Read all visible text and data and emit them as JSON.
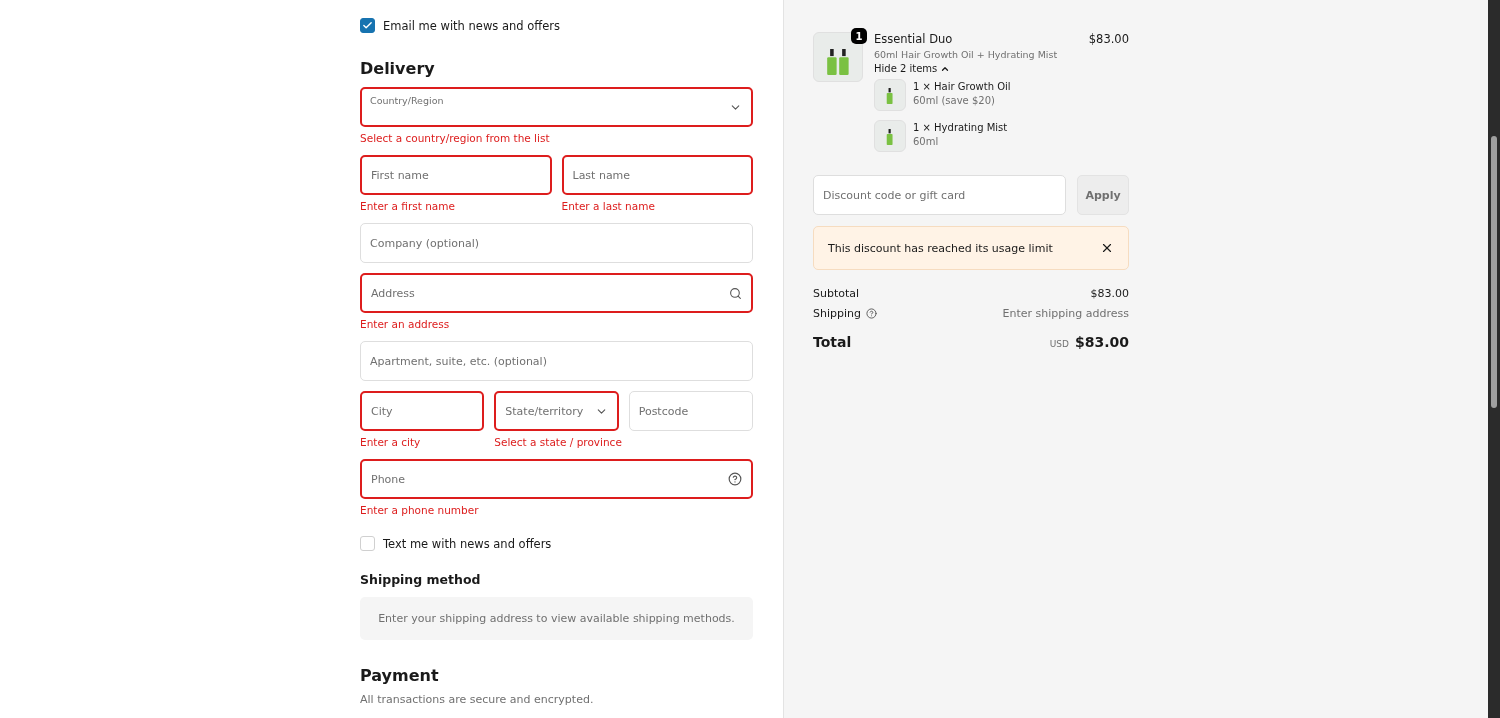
{
  "email_news": {
    "label": "Email me with news and offers",
    "checked": true
  },
  "delivery": {
    "heading": "Delivery",
    "rows": [
      [
        {
          "kind": "select",
          "label": "Country/Region",
          "invalid": true,
          "error": "Select a country/region from the list"
        }
      ],
      [
        {
          "kind": "text",
          "placeholder": "First name",
          "invalid": true,
          "error": "Enter a first name"
        },
        {
          "kind": "text",
          "placeholder": "Last name",
          "invalid": true,
          "error": "Enter a last name"
        }
      ],
      [
        {
          "kind": "text",
          "placeholder": "Company (optional)",
          "invalid": false
        }
      ],
      [
        {
          "kind": "search",
          "placeholder": "Address",
          "invalid": true,
          "error": "Enter an address"
        }
      ],
      [
        {
          "kind": "text",
          "placeholder": "Apartment, suite, etc. (optional)",
          "invalid": false
        }
      ],
      [
        {
          "kind": "text",
          "placeholder": "City",
          "invalid": true,
          "error": "Enter a city"
        },
        {
          "kind": "dropdown",
          "placeholder": "State/territory",
          "invalid": true,
          "error": "Select a state / province"
        },
        {
          "kind": "text",
          "placeholder": "Postcode",
          "invalid": false
        }
      ],
      [
        {
          "kind": "help",
          "placeholder": "Phone",
          "invalid": true,
          "error": "Enter a phone number"
        }
      ]
    ]
  },
  "text_news": {
    "label": "Text me with news and offers",
    "checked": false
  },
  "shipping_method": {
    "heading": "Shipping method",
    "message": "Enter your shipping address to view available shipping methods."
  },
  "payment": {
    "heading": "Payment",
    "subtitle": "All transactions are secure and encrypted."
  },
  "order": {
    "product": {
      "name": "Essential Duo",
      "variant": "60ml Hair Growth Oil + Hydrating Mist",
      "price": "$83.00",
      "quantity": "1",
      "toggle": "Hide 2 items",
      "expanded": true,
      "items": [
        {
          "name": "1 × Hair Growth Oil",
          "detail": "60ml (save $20)"
        },
        {
          "name": "1 × Hydrating Mist",
          "detail": "60ml"
        }
      ]
    },
    "discount": {
      "placeholder": "Discount code or gift card",
      "button": "Apply"
    },
    "alert": "This discount has reached its usage limit",
    "summary": [
      {
        "label": "Subtotal",
        "value": "$83.00",
        "help": false
      },
      {
        "label": "Shipping",
        "value": "Enter shipping address",
        "help": true
      }
    ],
    "total": {
      "label": "Total",
      "currency": "USD",
      "value": "$83.00"
    }
  }
}
